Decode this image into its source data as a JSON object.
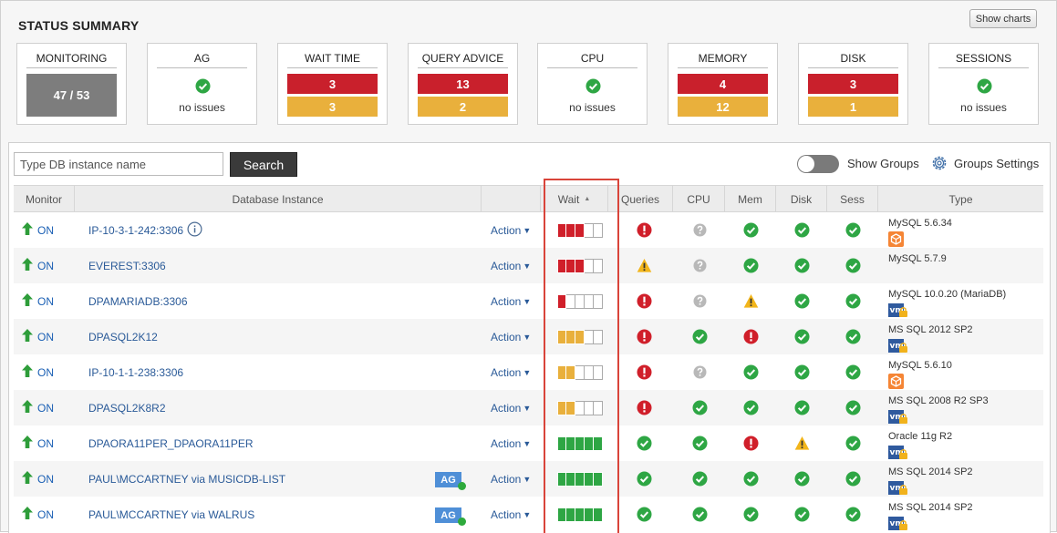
{
  "header": {
    "title": "STATUS SUMMARY",
    "show_charts_label": "Show charts"
  },
  "cards": [
    {
      "label": "MONITORING",
      "kind": "monitor",
      "value": "47 / 53"
    },
    {
      "label": "AG",
      "kind": "ok",
      "text": "no issues"
    },
    {
      "label": "WAIT TIME",
      "kind": "counts",
      "red": "3",
      "yellow": "3"
    },
    {
      "label": "QUERY ADVICE",
      "kind": "counts",
      "red": "13",
      "yellow": "2"
    },
    {
      "label": "CPU",
      "kind": "ok",
      "text": "no issues"
    },
    {
      "label": "MEMORY",
      "kind": "counts",
      "red": "4",
      "yellow": "12"
    },
    {
      "label": "DISK",
      "kind": "counts",
      "red": "3",
      "yellow": "1"
    },
    {
      "label": "SESSIONS",
      "kind": "ok",
      "text": "no issues"
    }
  ],
  "toolbar": {
    "search_placeholder": "Type DB instance name",
    "search_label": "Search",
    "show_groups_label": "Show Groups",
    "groups_settings_label": "Groups Settings"
  },
  "table": {
    "columns": [
      "Monitor",
      "Database Instance",
      "",
      "Wait",
      "Queries",
      "CPU",
      "Mem",
      "Disk",
      "Sess",
      "Type"
    ],
    "sort_indicator": "▲",
    "rows": [
      {
        "monitor": "ON",
        "instance": "IP-10-3-1-242:3306",
        "info": true,
        "ag": "",
        "action": "Action",
        "wait": [
          "red",
          "red",
          "red",
          "empty",
          "empty"
        ],
        "queries": "error",
        "cpu": "unknown",
        "mem": "ok",
        "disk": "ok",
        "sess": "ok",
        "type": "MySQL 5.6.34",
        "type_icon": "aws"
      },
      {
        "monitor": "ON",
        "instance": "EVEREST:3306",
        "info": false,
        "ag": "",
        "action": "Action",
        "wait": [
          "red",
          "red",
          "red",
          "empty",
          "empty"
        ],
        "queries": "warning",
        "cpu": "unknown",
        "mem": "ok",
        "disk": "ok",
        "sess": "ok",
        "type": "MySQL 5.7.9",
        "type_icon": ""
      },
      {
        "monitor": "ON",
        "instance": "DPAMARIADB:3306",
        "info": false,
        "ag": "",
        "action": "Action",
        "wait": [
          "red",
          "empty",
          "empty",
          "empty",
          "empty"
        ],
        "queries": "error",
        "cpu": "unknown",
        "mem": "warning",
        "disk": "ok",
        "sess": "ok",
        "type": "MySQL 10.0.20 (MariaDB)",
        "type_icon": "vm"
      },
      {
        "monitor": "ON",
        "instance": "DPASQL2K12",
        "info": false,
        "ag": "",
        "action": "Action",
        "wait": [
          "yellow",
          "yellow",
          "yellow",
          "empty",
          "empty"
        ],
        "queries": "error",
        "cpu": "ok",
        "mem": "error",
        "disk": "ok",
        "sess": "ok",
        "type": "MS SQL 2012 SP2",
        "type_icon": "vm"
      },
      {
        "monitor": "ON",
        "instance": "IP-10-1-1-238:3306",
        "info": false,
        "ag": "",
        "action": "Action",
        "wait": [
          "yellow",
          "yellow",
          "empty",
          "empty",
          "empty"
        ],
        "queries": "error",
        "cpu": "unknown",
        "mem": "ok",
        "disk": "ok",
        "sess": "ok",
        "type": "MySQL 5.6.10",
        "type_icon": "aws"
      },
      {
        "monitor": "ON",
        "instance": "DPASQL2K8R2",
        "info": false,
        "ag": "",
        "action": "Action",
        "wait": [
          "yellow",
          "yellow",
          "empty",
          "empty",
          "empty"
        ],
        "queries": "error",
        "cpu": "ok",
        "mem": "ok",
        "disk": "ok",
        "sess": "ok",
        "type": "MS SQL 2008 R2 SP3",
        "type_icon": "vm"
      },
      {
        "monitor": "ON",
        "instance": "DPAORA11PER_DPAORA11PER",
        "info": false,
        "ag": "",
        "action": "Action",
        "wait": [
          "green",
          "green",
          "green",
          "green",
          "green"
        ],
        "queries": "ok",
        "cpu": "ok",
        "mem": "error",
        "disk": "warning",
        "sess": "ok",
        "type": "Oracle 11g R2",
        "type_icon": "vm"
      },
      {
        "monitor": "ON",
        "instance": "PAUL\\MCCARTNEY via MUSICDB-LIST",
        "info": false,
        "ag": "AG",
        "action": "Action",
        "wait": [
          "green",
          "green",
          "green",
          "green",
          "green"
        ],
        "queries": "ok",
        "cpu": "ok",
        "mem": "ok",
        "disk": "ok",
        "sess": "ok",
        "type": "MS SQL 2014 SP2",
        "type_icon": "vm"
      },
      {
        "monitor": "ON",
        "instance": "PAUL\\MCCARTNEY via WALRUS",
        "info": false,
        "ag": "AG",
        "action": "Action",
        "wait": [
          "green",
          "green",
          "green",
          "green",
          "green"
        ],
        "queries": "ok",
        "cpu": "ok",
        "mem": "ok",
        "disk": "ok",
        "sess": "ok",
        "type": "MS SQL 2014 SP2",
        "type_icon": "vm"
      }
    ]
  },
  "colors": {
    "red": "#c9202c",
    "yellow": "#e9b03c",
    "green": "#2ea644",
    "link": "#2a5a98",
    "highlight": "#d9443a"
  }
}
